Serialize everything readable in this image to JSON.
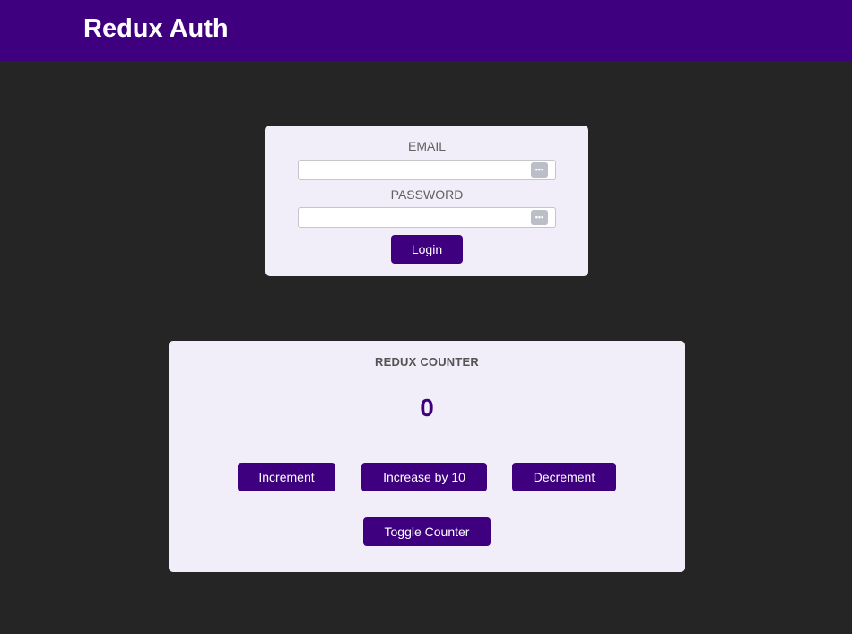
{
  "header": {
    "title": "Redux Auth"
  },
  "login": {
    "email_label": "EMAIL",
    "email_value": "",
    "password_label": "PASSWORD",
    "password_value": "",
    "password_manager_icon": "password-dots-icon",
    "login_button": "Login"
  },
  "counter": {
    "title": "REDUX COUNTER",
    "value": "0",
    "increment_button": "Increment",
    "increase_by_10_button": "Increase by 10",
    "decrement_button": "Decrement",
    "toggle_button": "Toggle Counter"
  },
  "colors": {
    "background": "#252525",
    "header": "#3f0080",
    "card": "#f1edf9",
    "accent": "#3f0080"
  }
}
